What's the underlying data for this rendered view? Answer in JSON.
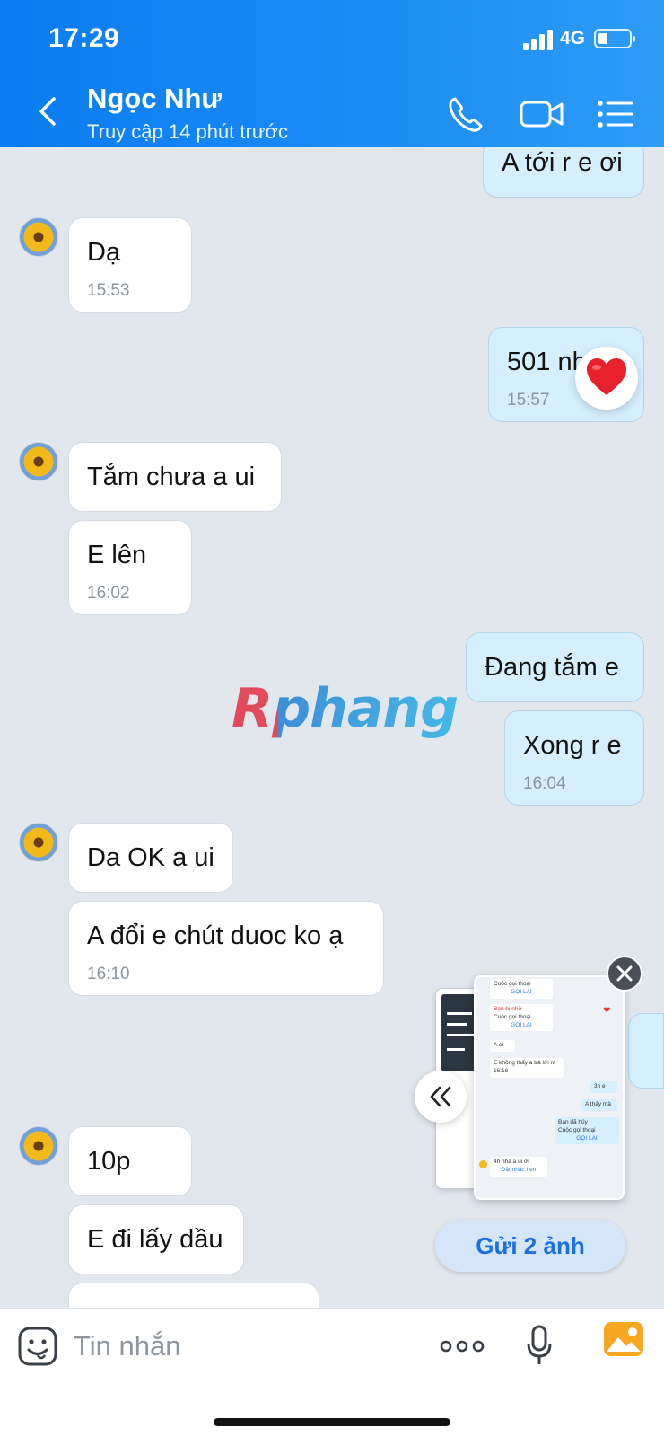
{
  "status_bar": {
    "time": "17:29",
    "network": "4G"
  },
  "header": {
    "contact_name": "Ngọc Như",
    "contact_status": "Truy cập 14 phút trước",
    "icons": [
      "back-icon",
      "phone-call-icon",
      "video-call-icon",
      "menu-list-icon"
    ]
  },
  "messages": [
    {
      "dir": "out",
      "text": "A tới r e ơi",
      "time": ""
    },
    {
      "dir": "in",
      "text": "Dạ",
      "time": "15:53"
    },
    {
      "dir": "out",
      "text": "501 nh",
      "time": "15:57",
      "reaction": "heart"
    },
    {
      "dir": "in",
      "text": "Tắm chưa a ui",
      "time": ""
    },
    {
      "dir": "in",
      "text": "E lên",
      "time": "16:02"
    },
    {
      "dir": "out",
      "text": "Đang tắm e",
      "time": ""
    },
    {
      "dir": "out",
      "text": "Xong r e",
      "time": "16:04"
    },
    {
      "dir": "in",
      "text": "Da OK a ui",
      "time": ""
    },
    {
      "dir": "in",
      "text": "A đổi e chút duoc ko ạ",
      "time": "16:10"
    },
    {
      "dir": "in",
      "text": "10p",
      "time": ""
    },
    {
      "dir": "in",
      "text": "E đi lấy dầu",
      "time": ""
    }
  ],
  "watermark": "Rphang",
  "image_preview": {
    "send_label": "Gửi 2 ảnh",
    "thumb_texts": {
      "call1": "Cuộc gọi thoại",
      "call_back": "GỌI LẠI",
      "missed": "Bạn bị nhỡ",
      "call2": "Cuộc gọi thoại",
      "call_back2": "GỌI LẠI",
      "a_oi": "A ơi",
      "e_khong": "E không thấy a trả lời nt",
      "e_time": "16:16",
      "three_h": "3h e",
      "a_thay": "A thấy mà",
      "canceled": "Bạn đã hủy",
      "call3": "Cuộc gọi thoại",
      "call_back3": "GỌI LẠI",
      "four_h": "4h nha a ui ơi",
      "set_reminder": "Đặt nhắc hẹn"
    }
  },
  "input": {
    "placeholder": "Tin nhắn"
  }
}
